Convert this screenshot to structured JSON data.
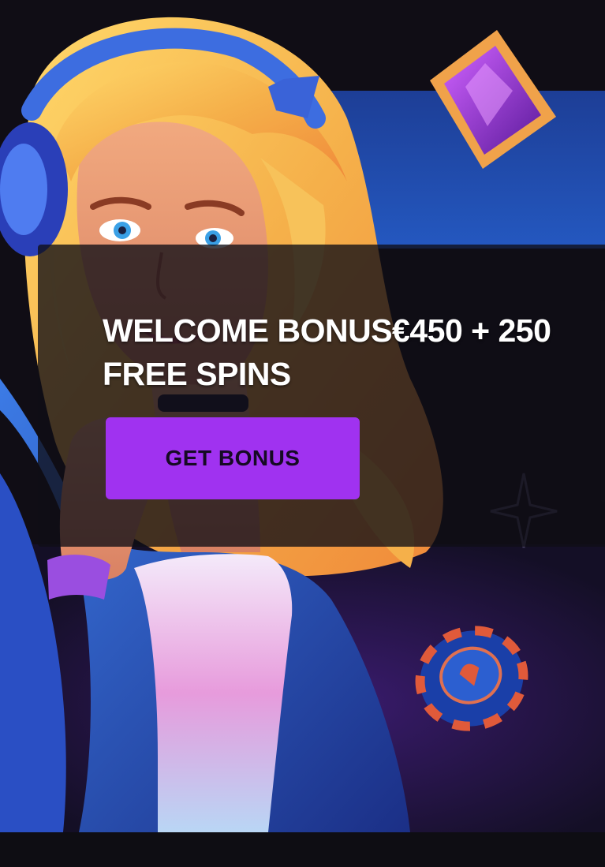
{
  "promo": {
    "headline": "WELCOME BONUS€450 + 250 FREE SPINS",
    "cta_label": "GET BONUS"
  },
  "illustration": {
    "character": "blonde-girl-with-headphones",
    "decorations": [
      "purple-gem-icon",
      "casino-chip-icon",
      "sparkle-icon"
    ]
  },
  "colors": {
    "background": "#100d15",
    "banner_blue": "#1f4fb0",
    "cta_background": "#a032f0",
    "cta_text": "#160a24",
    "headline_text": "#ffffff",
    "overlay": "#100e16"
  }
}
